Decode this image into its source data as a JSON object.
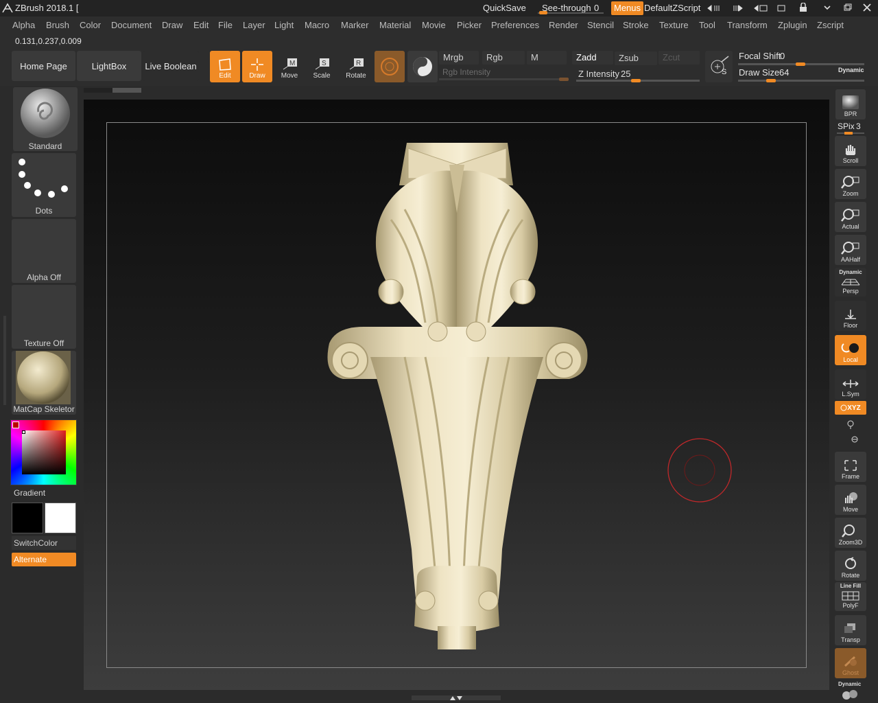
{
  "title_bar": {
    "app_title": "ZBrush 2018.1 [",
    "quicksave": "QuickSave",
    "see_through_label": "See-through",
    "see_through_value": "0",
    "menus": "Menus",
    "script": "DefaultZScript"
  },
  "menu": [
    "Alpha",
    "Brush",
    "Color",
    "Document",
    "Draw",
    "Edit",
    "File",
    "Layer",
    "Light",
    "Macro",
    "Marker",
    "Material",
    "Movie",
    "Picker",
    "Preferences",
    "Render",
    "Stencil",
    "Stroke",
    "Texture",
    "Tool",
    "Transform",
    "Zplugin",
    "Zscript"
  ],
  "coords": "0.131,0.237,0.009",
  "shelf": {
    "home_page": "Home Page",
    "lightbox": "LightBox",
    "live_boolean": "Live Boolean",
    "edit": "Edit",
    "draw": "Draw",
    "move": "Move",
    "scale": "Scale",
    "rotate": "Rotate",
    "mrgb": "Mrgb",
    "rgb": "Rgb",
    "m": "M",
    "rgb_intensity": "Rgb Intensity",
    "zadd": "Zadd",
    "zsub": "Zsub",
    "zcut": "Zcut",
    "z_intensity_label": "Z Intensity",
    "z_intensity_value": "25",
    "focal_shift_label": "Focal Shift",
    "focal_shift_value": "0",
    "draw_size_label": "Draw Size",
    "draw_size_value": "64",
    "dynamic": "Dynamic"
  },
  "left_panel": {
    "brush": "Standard",
    "stroke": "Dots",
    "alpha": "Alpha Off",
    "texture": "Texture Off",
    "material": "MatCap Skeletor",
    "gradient": "Gradient",
    "switch_color": "SwitchColor",
    "alternate": "Alternate"
  },
  "right_panel": {
    "bpr": "BPR",
    "spix_label": "SPix",
    "spix_value": "3",
    "scroll": "Scroll",
    "zoom": "Zoom",
    "actual": "Actual",
    "aahalf": "AAHalf",
    "persp_top": "Dynamic",
    "persp": "Persp",
    "floor": "Floor",
    "local": "Local",
    "lsym": "L.Sym",
    "xyz": "XYZ",
    "frame": "Frame",
    "move": "Move",
    "zoom3d": "Zoom3D",
    "rotate": "Rotate",
    "line_fill": "Line Fill",
    "polyf": "PolyF",
    "transp": "Transp",
    "ghost": "Ghost",
    "dynamic": "Dynamic"
  },
  "colors": {
    "accent": "#f08a24",
    "model": "#e8dcb8",
    "brush_cursor": "#c0282a"
  }
}
